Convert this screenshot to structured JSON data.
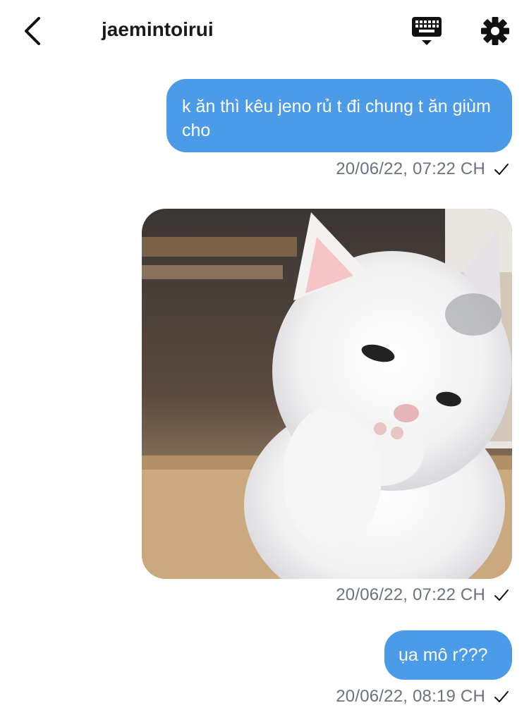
{
  "header": {
    "title": "jaemintoirui",
    "back_icon": "chevron-left-icon",
    "keyboard_icon": "keyboard-icon",
    "settings_icon": "gear-icon"
  },
  "messages": [
    {
      "type": "text",
      "text": "k ăn thì kêu jeno rủ t đi chung t ăn giùm cho",
      "timestamp": "20/06/22, 07:22 CH",
      "status_icon": "checkmark-icon"
    },
    {
      "type": "image",
      "image_description_icon": "kitten-photo",
      "timestamp": "20/06/22, 07:22 CH",
      "status_icon": "checkmark-icon"
    },
    {
      "type": "text",
      "text": "ụa mô r???",
      "timestamp": "20/06/22, 08:19 CH",
      "status_icon": "checkmark-icon"
    }
  ],
  "colors": {
    "bubble": "#4c9be8",
    "timestamp": "#6b7280"
  }
}
